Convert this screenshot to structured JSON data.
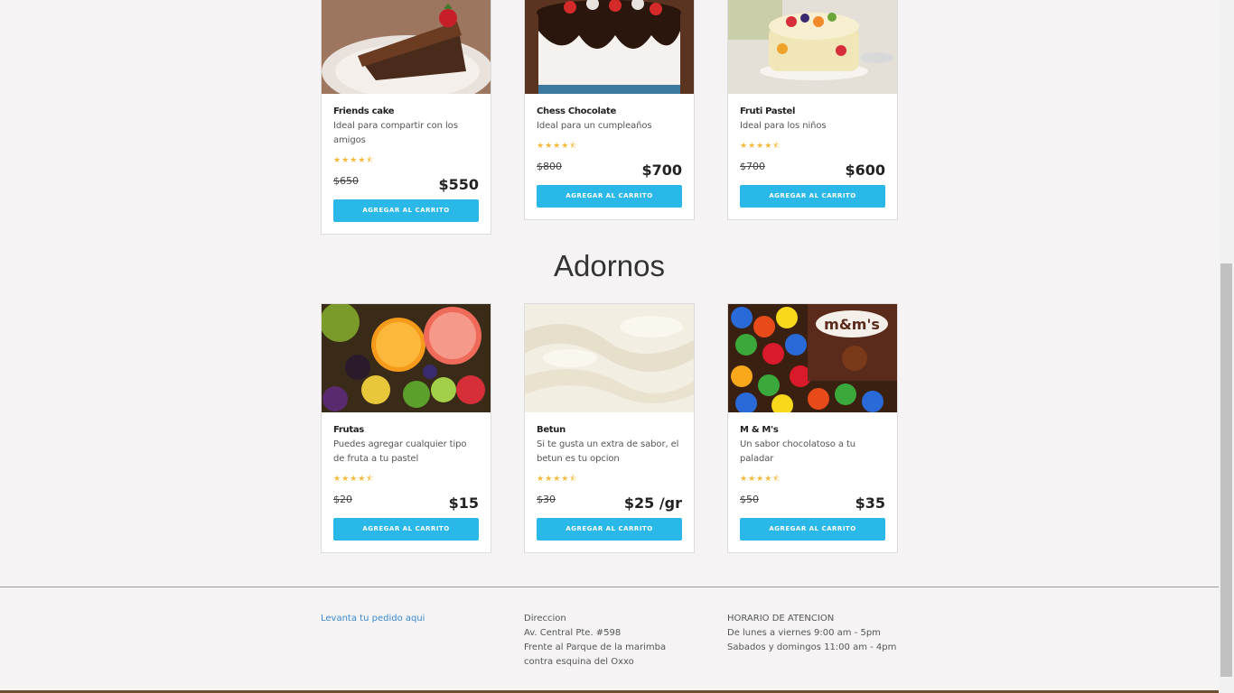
{
  "cakes": [
    {
      "name": "Friends cake",
      "desc": "Ideal para compartir con los amigos",
      "old_price": "$650",
      "price": "$550",
      "button": "AGREGAR AL CARRITO",
      "image_icon": "chocolate-cake-slice-image"
    },
    {
      "name": "Chess Chocolate",
      "desc": "Ideal para un cumpleaños",
      "old_price": "$800",
      "price": "$700",
      "button": "AGREGAR AL CARRITO",
      "image_icon": "chocolate-strawberry-cake-image"
    },
    {
      "name": "Fruti Pastel",
      "desc": "Ideal para los niños",
      "old_price": "$700",
      "price": "$600",
      "button": "AGREGAR AL CARRITO",
      "image_icon": "fruit-cake-image"
    }
  ],
  "adornos_title": "Adornos",
  "adornos": [
    {
      "name": "Frutas",
      "desc": "Puedes agregar cualquier tipo de fruta a tu pastel",
      "old_price": "$20",
      "price": "$15",
      "button": "AGREGAR AL CARRITO",
      "image_icon": "fruits-image"
    },
    {
      "name": "Betun",
      "desc": "Si te gusta un extra de sabor, el betun es tu opcion",
      "old_price": "$30",
      "price": "$25 /gr",
      "button": "AGREGAR AL CARRITO",
      "image_icon": "frosting-image"
    },
    {
      "name": "M & M's",
      "desc": "Un sabor chocolatoso a tu paladar",
      "old_price": "$50",
      "price": "$35",
      "button": "AGREGAR AL CARRITO",
      "image_icon": "mms-candy-image"
    }
  ],
  "rating_stars": "★★★★⯪",
  "footer": {
    "order_link": "Levanta tu pedido aqui",
    "address_title": "Direccion",
    "address_line1": "Av. Central Pte. #598",
    "address_line2": "Frente al Parque de la marimba contra esquina del Oxxo",
    "hours_title": "HORARIO DE ATENCION",
    "hours_line1": "De lunes a viernes 9:00 am - 5pm",
    "hours_line2": "Sabados y domingos 11:00 am - 4pm"
  },
  "colors": {
    "button": "#29b8e8",
    "stars": "#f6b83a",
    "link": "#3a8bd0"
  }
}
